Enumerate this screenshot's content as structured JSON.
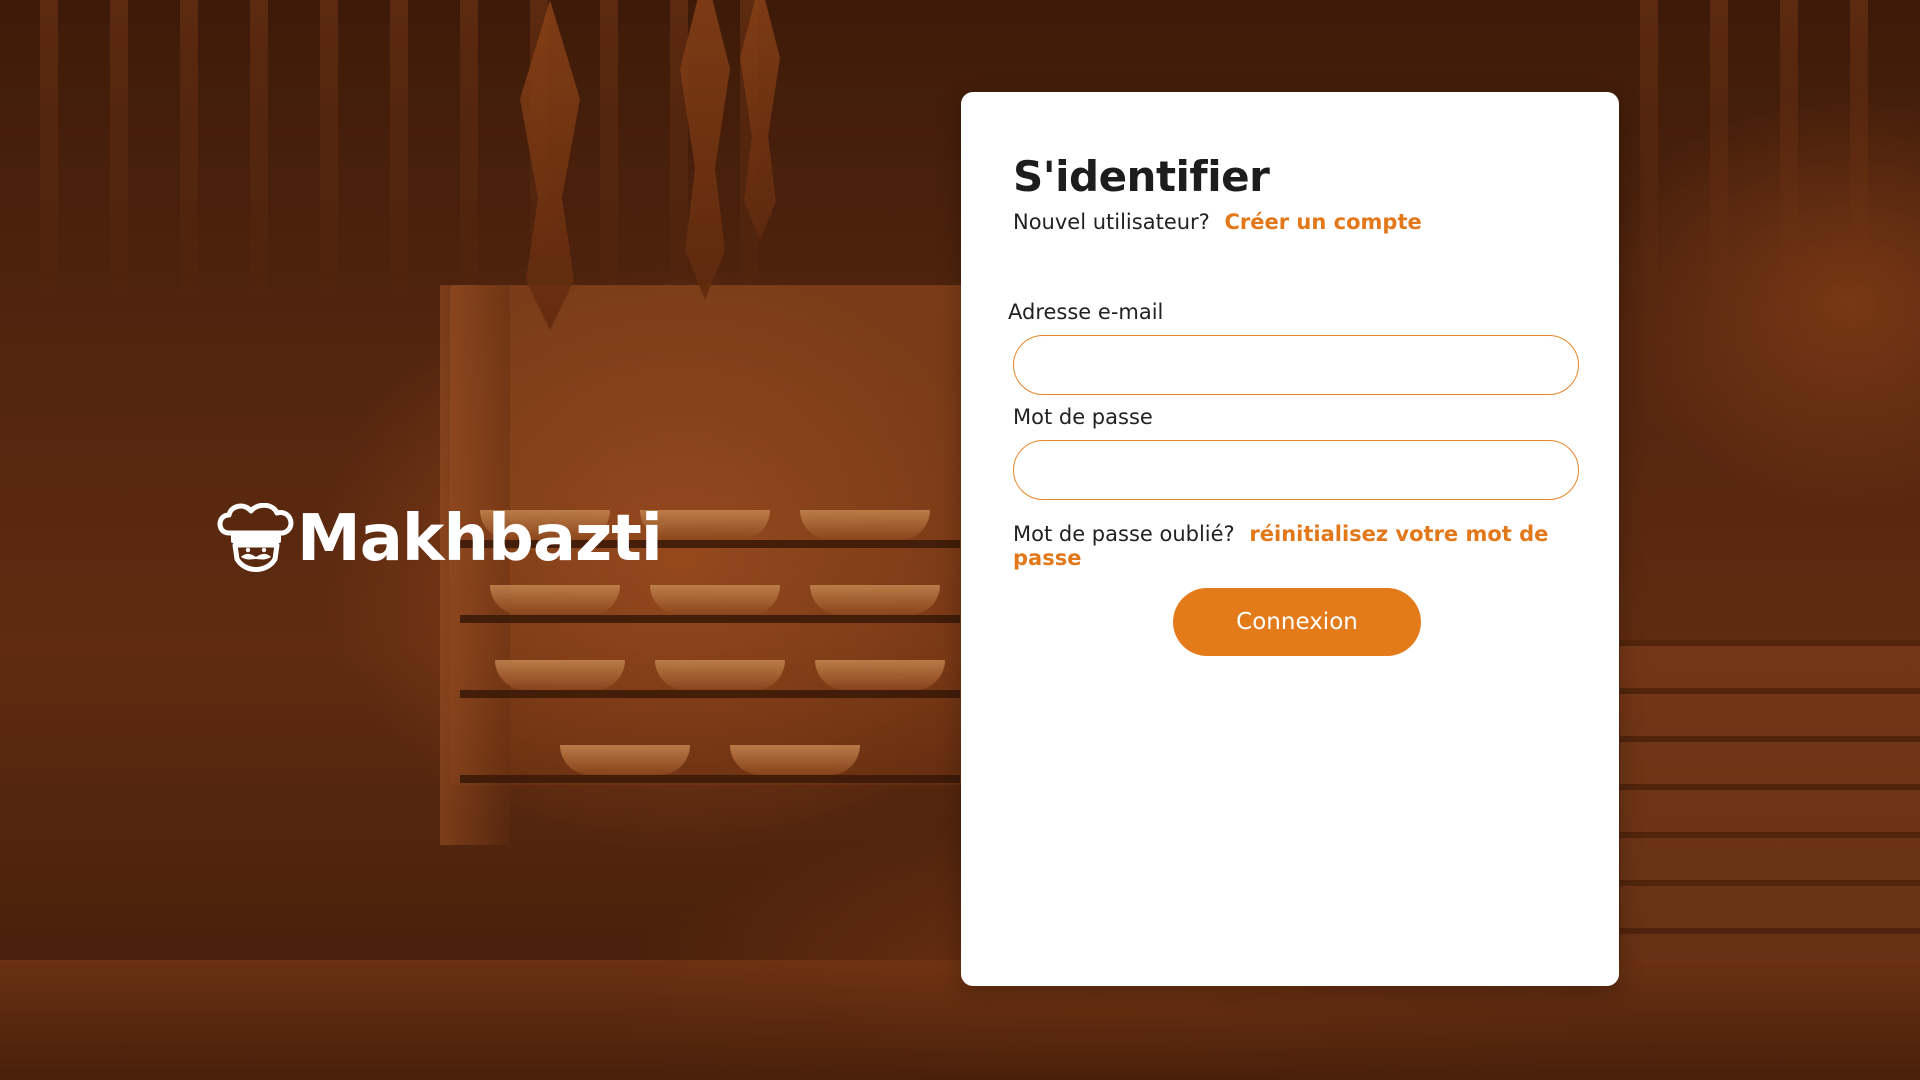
{
  "brand": {
    "name": "Makhbazti",
    "logo_icon": "chef-hat-mustache-icon"
  },
  "login": {
    "title": "S'identifier",
    "new_user_prompt": "Nouvel utilisateur?",
    "create_account_link": "Créer un compte",
    "email_label": "Adresse e-mail",
    "email_value": "",
    "password_label": "Mot de passe",
    "password_value": "",
    "forgot_prompt": "Mot de passe oublié?",
    "reset_link": "réinitialisez votre mot de passe",
    "submit_label": "Connexion"
  },
  "colors": {
    "accent": "#e47b1b",
    "input_border": "#e8852a",
    "card_background": "#ffffff",
    "background_tint": "#6e2c08"
  }
}
